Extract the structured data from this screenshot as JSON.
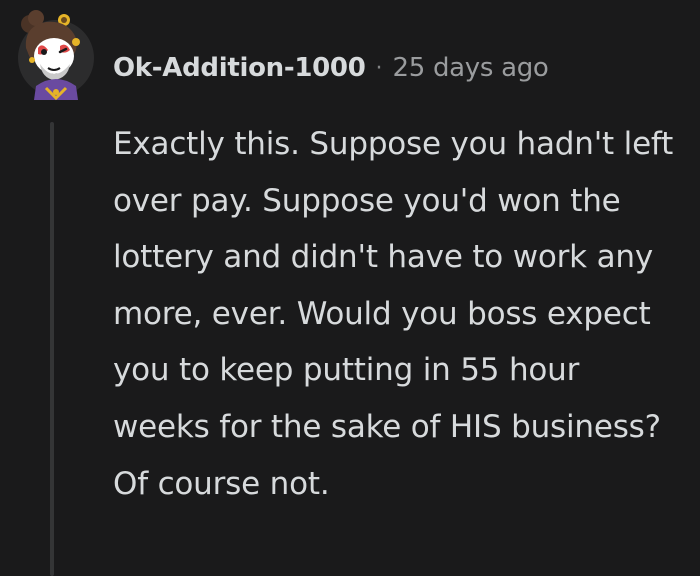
{
  "comment": {
    "username": "Ok-Addition-1000",
    "separator": "·",
    "timestamp": "25 days ago",
    "body": "Exactly this. Suppose you hadn't left over pay. Suppose you'd won the lottery and didn't have to work any more, ever. Would you boss expect you to keep putting in 55 hour weeks for the sake of HIS business? Of course not.",
    "avatar_icon": "snoo-avatar-icon"
  },
  "colors": {
    "background": "#1a1a1b",
    "text": "#d7dadc",
    "muted": "#9a9c9e",
    "thread_line": "#343536"
  }
}
